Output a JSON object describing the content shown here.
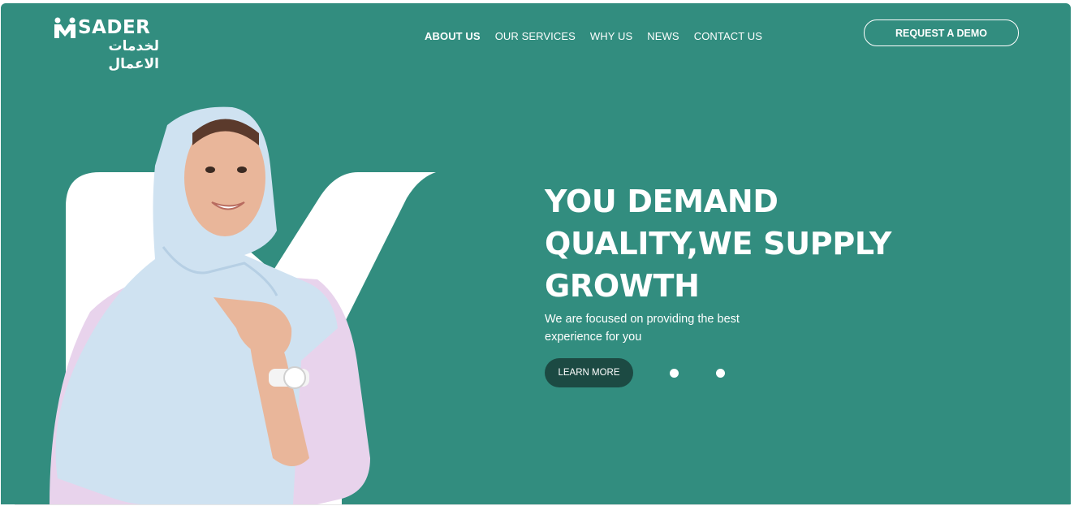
{
  "brand": {
    "name": "SADER",
    "arabic_tagline": "لخدمات الاعمال",
    "brand_color": "#328d7f"
  },
  "nav": {
    "items": [
      {
        "label": "ABOUT US",
        "active": true
      },
      {
        "label": "OUR SERVICES",
        "active": false
      },
      {
        "label": "WHY US",
        "active": false
      },
      {
        "label": "NEWS",
        "active": false
      },
      {
        "label": "CONTACT US",
        "active": false
      }
    ]
  },
  "header": {
    "cta_label": "REQUEST A DEMO"
  },
  "hero": {
    "title_lines": [
      "YOU DEMAND",
      "QUALITY,WE SUPPLY",
      "GROWTH"
    ],
    "subtitle_lines": [
      "We are focused on providing the best",
      "experience for you"
    ],
    "button_label": "LEARN MORE",
    "accent_dark": "#1c4a43",
    "slider_dots": 2
  }
}
